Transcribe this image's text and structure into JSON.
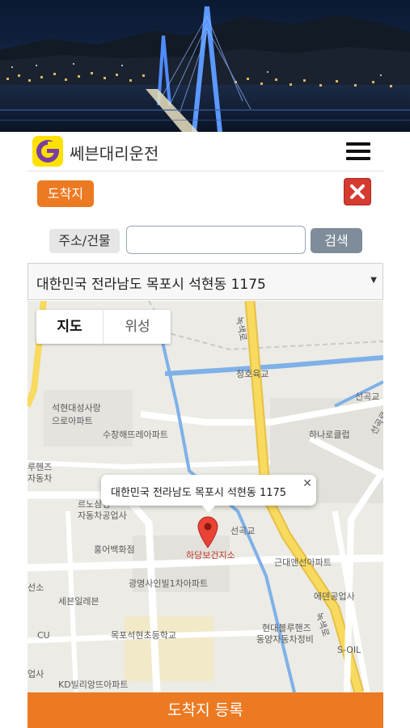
{
  "header": {
    "app_title": "쎄븐대리운전"
  },
  "toolbar": {
    "badge": "도착지"
  },
  "search": {
    "label": "주소/건물",
    "input_value": "",
    "input_placeholder": "",
    "button": "검색"
  },
  "address_select": {
    "selected": "대한민국 전라남도 목포시 석현동 1175"
  },
  "map": {
    "type_tabs": [
      "지도",
      "위성"
    ],
    "info_window": "대한민국 전라남도 목포시 석현동 1175",
    "labels": {
      "cheongho": "청호육교",
      "seokgok_top": "선곡교",
      "suwon1": "석현대성사랑",
      "suwon2": "으로아파트",
      "suchang": "수창해뜨레아파트",
      "hanaro": "하나로클럽",
      "seokgok_right": "선곡로",
      "rehens1": "루헨즈",
      "rehens2": "자동차",
      "renos1": "르노삼성",
      "renos2": "자동차공업사",
      "hongeo": "홍어백화점",
      "seokgok_pin": "선곡교",
      "hadang": "하당보건지소",
      "geunae": "근대앤선아파트",
      "gwangmyeong": "광명사인빌1차아파트",
      "seons": "선소",
      "seven": "세븐일레븐",
      "eden": "에덴공업사",
      "cu": "CU",
      "mokpo_school": "목포석현초등학교",
      "hyundai1": "현대블루핸즈",
      "hyundai2": "동양자동차정비",
      "soil": "S-OIL",
      "gyeongsa": "업사",
      "kd": "KD빌리앙뜨아파트",
      "road_top": "녹색로",
      "road_bottom": "녹색로"
    }
  },
  "footer": {
    "submit": "도착지 등록"
  },
  "colors": {
    "accent": "#ec7a22",
    "close": "#d43a2f",
    "search_button": "#7e8d99",
    "road_major": "#f5d04a",
    "water": "#7fb1e8"
  }
}
